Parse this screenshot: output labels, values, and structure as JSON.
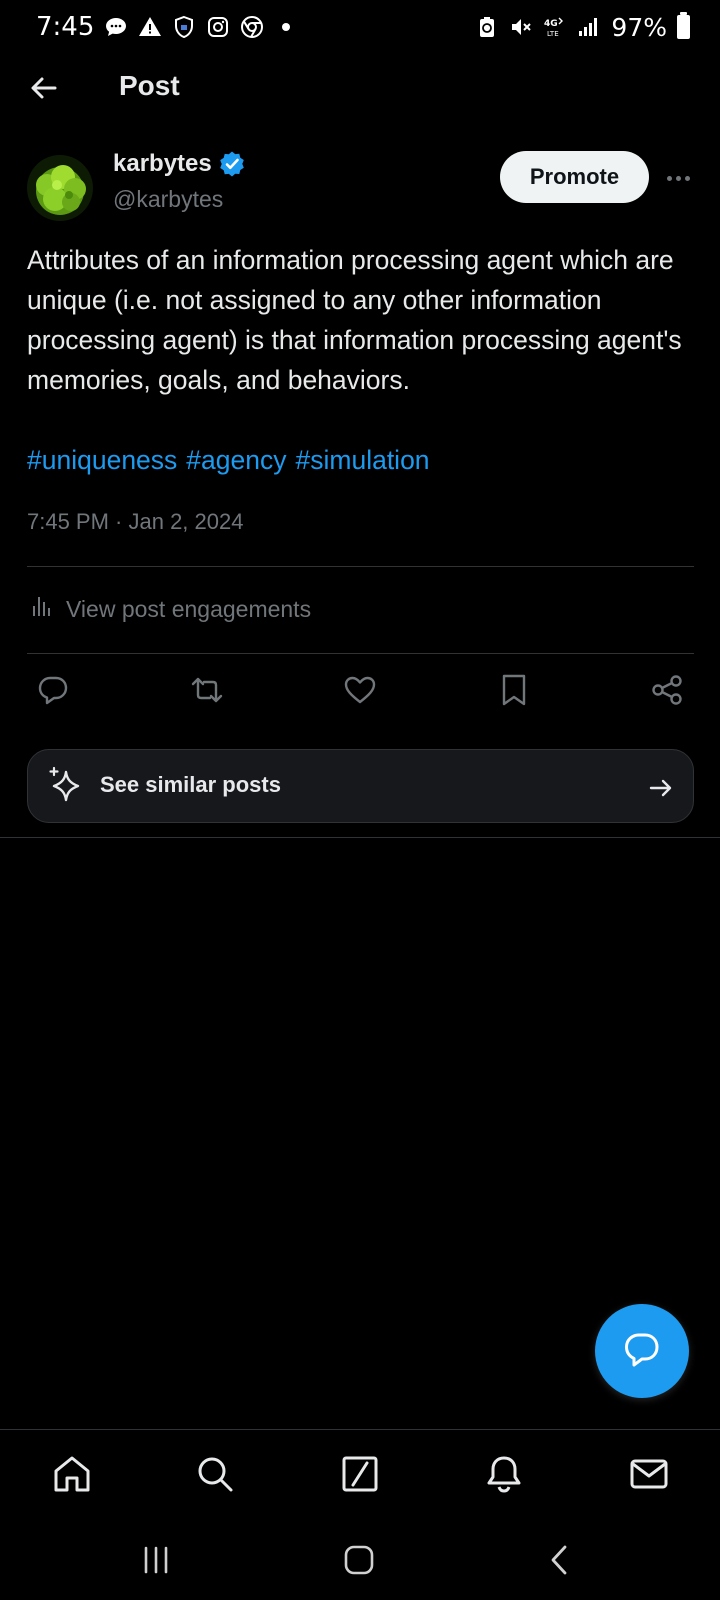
{
  "status_bar": {
    "time": "7:45",
    "battery": "97%",
    "notification_icons": [
      "chat-icon",
      "warning-icon",
      "shield-icon",
      "instagram-icon",
      "chrome-icon",
      "dot-icon"
    ],
    "system_icons": [
      "battery-saver-icon",
      "mute-icon",
      "lte-icon",
      "signal-icon"
    ]
  },
  "header": {
    "title": "Post"
  },
  "post": {
    "author_name": "karbytes",
    "author_handle": "@karbytes",
    "promote_label": "Promote",
    "text": "Attributes of an information processing agent which are unique (i.e. not assigned to any other information processing agent) is that information processing agent's memories, goals, and behaviors.",
    "hashtags": [
      "#uniqueness",
      "#agency",
      "#simulation"
    ],
    "timestamp": "7:45 PM · Jan 2, 2024",
    "engagements_label": "View post engagements",
    "similar_label": "See similar posts"
  },
  "colors": {
    "accent": "#1d9bf0",
    "background": "#000000",
    "text": "#e7e9ea",
    "muted": "#71767b",
    "divider": "#2f3336"
  },
  "bottom_nav": [
    "home-icon",
    "search-icon",
    "grok-icon",
    "notifications-icon",
    "messages-icon"
  ],
  "system_nav": [
    "recents-icon",
    "home-button-icon",
    "back-icon"
  ]
}
